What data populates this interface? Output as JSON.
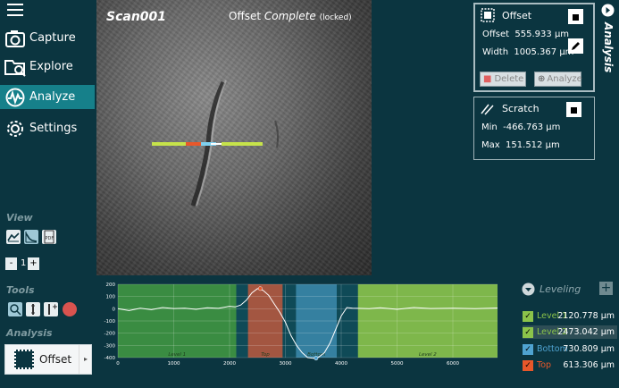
{
  "nav": {
    "items": [
      {
        "label": "Capture",
        "icon": "camera-icon"
      },
      {
        "label": "Explore",
        "icon": "folder-search-icon"
      },
      {
        "label": "Analyze",
        "icon": "waveform-icon"
      },
      {
        "label": "Settings",
        "icon": "gear-icon"
      }
    ],
    "active": "Analyze"
  },
  "view": {
    "label": "View",
    "stepper_value": "1",
    "minus": "-",
    "plus": "+"
  },
  "tools": {
    "label": "Tools"
  },
  "analysis": {
    "label": "Analysis",
    "selected": "Offset",
    "arrow": "▸"
  },
  "scan": {
    "title": "Scan001",
    "status_prefix": "Offset",
    "status_state": "Complete",
    "status_suffix": "(locked)"
  },
  "offset_panel": {
    "title": "Offset",
    "offset_label": "Offset",
    "offset_value": "555.933 µm",
    "width_label": "Width",
    "width_value": "1005.367 µm",
    "delete_label": "Delete",
    "analyze_label": "Analyze"
  },
  "scratch_panel": {
    "title": "Scratch",
    "min_label": "Min",
    "min_value": "-466.763 µm",
    "max_label": "Max",
    "max_value": "151.512 µm"
  },
  "side_tab": {
    "label": "Analysis"
  },
  "leveling": {
    "header": "Leveling",
    "rows": [
      {
        "label": "Level 1",
        "value": "2120.778 µm",
        "color": "#8bc34a"
      },
      {
        "label": "Level 2",
        "value": "2473.042 µm",
        "color": "#8bc34a"
      },
      {
        "label": "Bottom",
        "value": "730.809 µm",
        "color": "#4fa3d1"
      },
      {
        "label": "Top",
        "value": "613.306 µm",
        "color": "#e8572a"
      }
    ]
  },
  "chart_data": {
    "type": "line",
    "xlim": [
      0,
      6800
    ],
    "ylim": [
      -400,
      200
    ],
    "xticks": [
      0,
      1000,
      2000,
      3000,
      4000,
      5000,
      6000
    ],
    "yticks": [
      200,
      100,
      0,
      -100,
      -200,
      -300,
      -400
    ],
    "regions": [
      {
        "label": "Level 1",
        "x0": 0,
        "x1": 2120,
        "color": "#3f9440"
      },
      {
        "label": "Top",
        "x0": 2330,
        "x1": 2950,
        "color": "#b4583f"
      },
      {
        "label": "Bottom",
        "x0": 3190,
        "x1": 3920,
        "color": "#3a86a8"
      },
      {
        "label": "Level 2",
        "x0": 4300,
        "x1": 6800,
        "color": "#8bc34a"
      }
    ],
    "series": [
      {
        "x": [
          0,
          200,
          400,
          600,
          800,
          1000,
          1200,
          1400,
          1600,
          1800,
          2000,
          2100,
          2200,
          2300,
          2400,
          2500,
          2600,
          2700,
          2800,
          2900,
          3000,
          3100,
          3200,
          3300,
          3400,
          3500,
          3600,
          3700,
          3800,
          3900,
          4000,
          4100,
          4200,
          4300,
          4500,
          4700,
          5000,
          5300,
          5600,
          6000,
          6400,
          6800
        ],
        "y": [
          0,
          -15,
          5,
          -8,
          10,
          2,
          5,
          -5,
          8,
          3,
          20,
          15,
          30,
          70,
          130,
          165,
          150,
          110,
          40,
          -30,
          -110,
          -220,
          -300,
          -360,
          -400,
          -405,
          -395,
          -360,
          -280,
          -170,
          -60,
          10,
          5,
          3,
          0,
          8,
          -5,
          10,
          2,
          5,
          0,
          6
        ]
      }
    ],
    "markers": [
      {
        "x": 2550,
        "y": 165,
        "color": "#e8572a"
      },
      {
        "x": 3550,
        "y": -405,
        "color": "#4fa3d1"
      }
    ]
  }
}
